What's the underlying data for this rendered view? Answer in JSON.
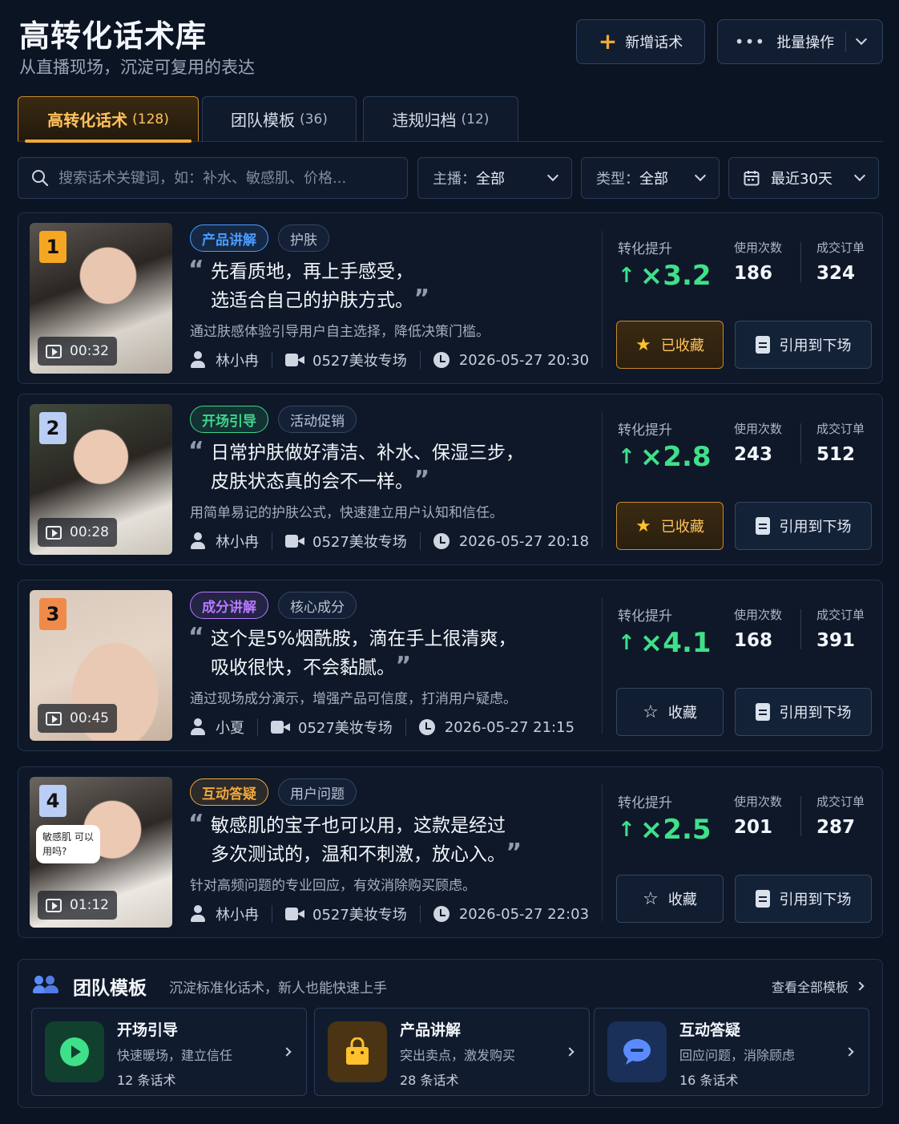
{
  "header": {
    "title": "高转化话术库",
    "subtitle": "从直播现场，沉淀可复用的表达",
    "new_button": "新增话术",
    "batch_button": "批量操作"
  },
  "tabs": [
    {
      "label": "高转化话术",
      "count": "(128)",
      "active": true
    },
    {
      "label": "团队模板",
      "count": "(36)"
    },
    {
      "label": "违规归档",
      "count": "(12)"
    }
  ],
  "filters": {
    "search_placeholder": "搜索话术关键词，如：补水、敏感肌、价格...",
    "host_label": "主播：",
    "host_value": "全部",
    "type_label": "类型：",
    "type_value": "全部",
    "date_value": "最近30天"
  },
  "stat_labels": {
    "lift": "转化提升",
    "uses": "使用次数",
    "orders": "成交订单"
  },
  "actions": {
    "favorited": "已收藏",
    "favorite": "收藏",
    "cite": "引用到下场"
  },
  "cards": [
    {
      "rank": "1",
      "duration": "00:32",
      "tag_main": "产品讲解",
      "tag_sub": "护肤",
      "line1": "先看质地，再上手感受，",
      "line2": "选适合自己的护肤方式。",
      "desc": "通过肤感体验引导用户自主选择，降低决策门槛。",
      "host": "林小冉",
      "session": "0527美妆专场",
      "time": "2026-05-27 20:30",
      "lift": "×3.2",
      "uses": "186",
      "orders": "324",
      "favorited": true
    },
    {
      "rank": "2",
      "duration": "00:28",
      "tag_main": "开场引导",
      "tag_sub": "活动促销",
      "line1": "日常护肤做好清洁、补水、保湿三步，",
      "line2": "皮肤状态真的会不一样。",
      "desc": "用简单易记的护肤公式，快速建立用户认知和信任。",
      "host": "林小冉",
      "session": "0527美妆专场",
      "time": "2026-05-27 20:18",
      "lift": "×2.8",
      "uses": "243",
      "orders": "512",
      "favorited": true
    },
    {
      "rank": "3",
      "duration": "00:45",
      "tag_main": "成分讲解",
      "tag_sub": "核心成分",
      "line1": "这个是5%烟酰胺，滴在手上很清爽，",
      "line2": "吸收很快，不会黏腻。",
      "desc": "通过现场成分演示，增强产品可信度，打消用户疑虑。",
      "host": "小夏",
      "session": "0527美妆专场",
      "time": "2026-05-27 21:15",
      "lift": "×4.1",
      "uses": "168",
      "orders": "391",
      "favorited": false
    },
    {
      "rank": "4",
      "duration": "01:12",
      "bubble": "敏感肌 可以用吗?",
      "tag_main": "互动答疑",
      "tag_sub": "用户问题",
      "line1": "敏感肌的宝子也可以用，这款是经过",
      "line2": "多次测试的，温和不刺激，放心入。",
      "desc": "针对高频问题的专业回应，有效消除购买顾虑。",
      "host": "林小冉",
      "session": "0527美妆专场",
      "time": "2026-05-27 22:03",
      "lift": "×2.5",
      "uses": "201",
      "orders": "287",
      "favorited": false
    }
  ],
  "team": {
    "title": "团队模板",
    "subtitle": "沉淀标准化话术，新人也能快速上手",
    "view_all": "查看全部模板",
    "templates": [
      {
        "name": "开场引导",
        "desc": "快速暖场，建立信任",
        "count": "12 条话术"
      },
      {
        "name": "产品讲解",
        "desc": "突出卖点，激发购买",
        "count": "28 条话术"
      },
      {
        "name": "互动答疑",
        "desc": "回应问题，消除顾虑",
        "count": "16 条话术"
      }
    ]
  },
  "colors": {
    "accent": "#f0a83a",
    "lift_green": "#3fe08a",
    "rank_colors": [
      "#f5a623",
      "#b9cdf5",
      "#f08a4b",
      "#b9cdf5"
    ],
    "tag_colors": [
      "#4b9bff",
      "#3fd68a",
      "#b779ff",
      "#f0a83a"
    ]
  }
}
